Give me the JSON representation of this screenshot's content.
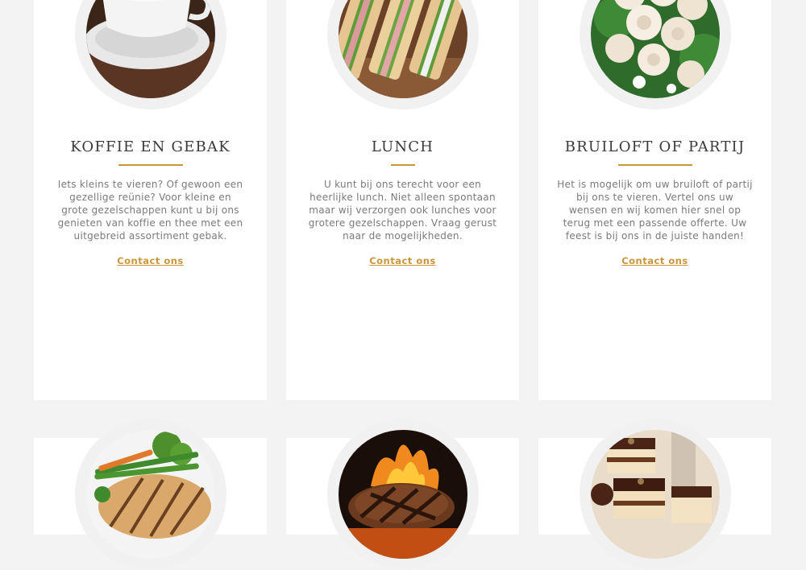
{
  "services": [
    {
      "title": "KOFFIE EN GEBAK",
      "image": "coffee-cup-photo",
      "description": "Iets kleins te vieren? Of gewoon een gezellige reünie? Voor kleine en grote gezelschappen kunt u bij ons genieten van koffie en thee met een uitgebreid assortiment gebak.",
      "link": "Contact ons"
    },
    {
      "title": "LUNCH",
      "image": "sandwiches-photo",
      "description": "U kunt bij ons terecht voor een heerlijke lunch. Niet alleen spontaan maar wij verzorgen ook lunches voor grotere gezelschappen. Vraag gerust naar de mogelijkheden.",
      "link": "Contact ons"
    },
    {
      "title": "BRUILOFT OF PARTIJ",
      "image": "rose-bouquet-photo",
      "description": "Het is mogelijk om uw bruiloft of partij bij ons te vieren. Vertel ons uw wensen en wij komen hier snel op terug met een passende offerte. Uw feest is bij ons in de juiste handen!",
      "link": "Contact ons"
    }
  ],
  "more_services": [
    {
      "image": "grilled-chicken-vegetables-photo"
    },
    {
      "image": "grilled-steak-flames-photo"
    },
    {
      "image": "chocolate-cakes-photo"
    }
  ],
  "colors": {
    "background": "#f3f3f3",
    "card": "#ffffff",
    "accent": "#c8963e",
    "heading": "#3a3a3a",
    "body_text": "#7a7a7a"
  }
}
